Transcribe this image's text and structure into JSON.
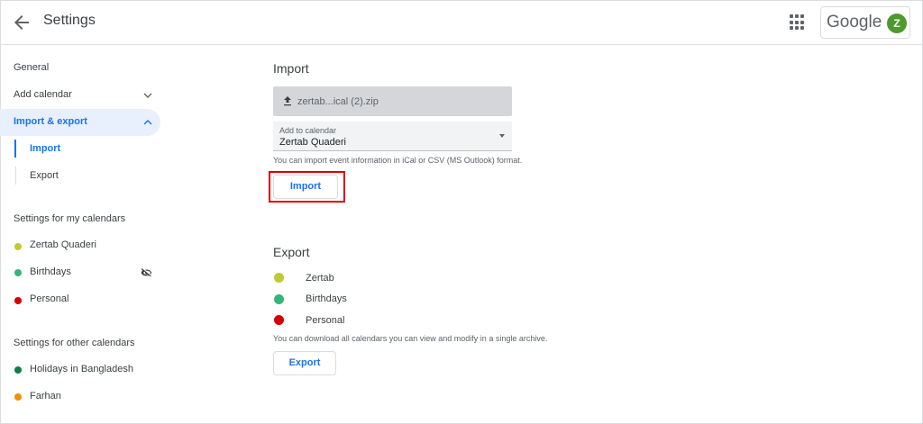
{
  "header": {
    "title": "Settings",
    "brand_word": "Google",
    "avatar_letter": "Z"
  },
  "sidebar": {
    "general": "General",
    "add_calendar": "Add calendar",
    "import_export": "Import & export",
    "import": "Import",
    "export": "Export",
    "my_calendars_heading": "Settings for my calendars",
    "my_calendars": [
      {
        "name": "Zertab Quaderi",
        "color": "#c0ca33"
      },
      {
        "name": "Birthdays",
        "color": "#33b679"
      },
      {
        "name": "Personal",
        "color": "#d50000"
      }
    ],
    "other_calendars_heading": "Settings for other calendars",
    "other_calendars": [
      {
        "name": "Holidays in Bangladesh",
        "color": "#0b8043"
      },
      {
        "name": "Farhan",
        "color": "#f09300"
      }
    ]
  },
  "import_section": {
    "heading": "Import",
    "file_name": "zertab...ical (2).zip",
    "select_label": "Add to calendar",
    "select_value": "Zertab Quaderi",
    "hint": "You can import event information in iCal or CSV (MS Outlook) format.",
    "button": "Import"
  },
  "export_section": {
    "heading": "Export",
    "calendars": [
      {
        "name": "Zertab",
        "color": "#c0ca33"
      },
      {
        "name": "Birthdays",
        "color": "#33b679"
      },
      {
        "name": "Personal",
        "color": "#d50000"
      }
    ],
    "hint": "You can download all calendars you can view and modify in a single archive.",
    "button": "Export"
  },
  "colors": {
    "accent": "#1a73e8",
    "highlight_outline": "#e00000",
    "active_row": "#e8f0fe"
  }
}
